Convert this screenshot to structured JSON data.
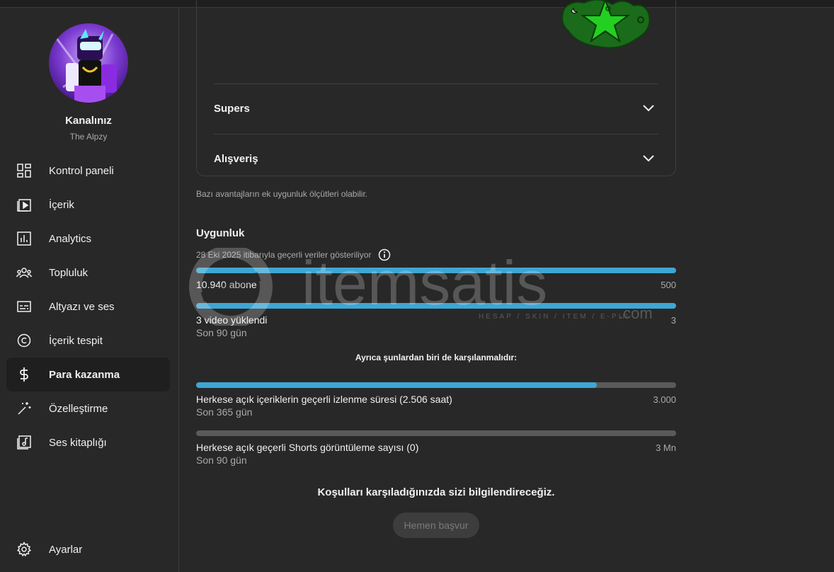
{
  "channel": {
    "title": "Kanalınız",
    "name": "The Alpzy"
  },
  "nav": [
    {
      "label": "Kontrol paneli",
      "icon": "dashboard-icon"
    },
    {
      "label": "İçerik",
      "icon": "content-icon"
    },
    {
      "label": "Analytics",
      "icon": "analytics-icon"
    },
    {
      "label": "Topluluk",
      "icon": "community-icon"
    },
    {
      "label": "Altyazı ve ses",
      "icon": "subtitles-icon"
    },
    {
      "label": "İçerik tespit",
      "icon": "copyright-icon"
    },
    {
      "label": "Para kazanma",
      "icon": "dollar-icon",
      "active": true
    },
    {
      "label": "Özelleştirme",
      "icon": "magic-wand-icon"
    },
    {
      "label": "Ses kitaplığı",
      "icon": "audio-library-icon"
    }
  ],
  "settings": {
    "label": "Ayarlar",
    "icon": "gear-icon"
  },
  "accordion": [
    {
      "label": "Supers"
    },
    {
      "label": "Alışveriş"
    }
  ],
  "note": "Bazı avantajların ek uygunluk ölçütleri olabilir.",
  "eligibility": {
    "title": "Uygunluk",
    "date_line": "28 Eki 2025 itibarıyla geçerli veriler gösteriliyor",
    "rows": [
      {
        "label": "10.940 abone",
        "sub": "",
        "target": "500",
        "progress": 1.0
      },
      {
        "label": "3 video yüklendi",
        "sub": "Son 90 gün",
        "target": "3",
        "progress": 1.0
      }
    ],
    "also_text": "Ayrıca şunlardan biri de karşılanmalıdır:",
    "alt_rows": [
      {
        "label": "Herkese açık içeriklerin geçerli izlenme süresi (2.506 saat)",
        "sub": "Son 365 gün",
        "target": "3.000",
        "progress": 0.835
      },
      {
        "label": "Herkese açık geçerli Shorts görüntüleme sayısı (0)",
        "sub": "Son 90 gün",
        "target": "3 Mn",
        "progress": 0.0
      }
    ]
  },
  "notify_text": "Koşulları karşıladığınızda sizi bilgilendireceğiz.",
  "apply_button": "Hemen başvur",
  "watermark": {
    "brand": "itemsatis",
    "tagline": "HESAP / SKIN / ITEM / E-PIN",
    "tld": ".com"
  },
  "colors": {
    "accent": "#3ea6d3",
    "track": "#5a5a5a",
    "background": "#282828"
  }
}
